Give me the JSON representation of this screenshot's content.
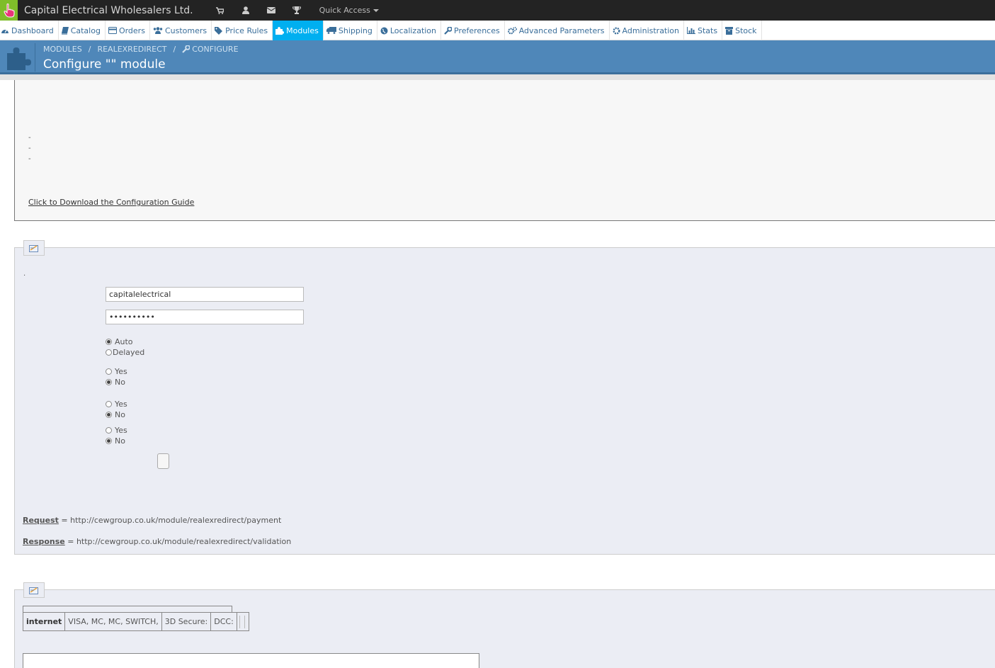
{
  "header": {
    "shop_name": "Capital Electrical Wholesalers Ltd.",
    "quick_access": "Quick Access",
    "icons": [
      "cart-icon",
      "user-icon",
      "envelope-icon",
      "trophy-icon"
    ]
  },
  "nav": {
    "items": [
      {
        "label": "Dashboard",
        "icon": "dashboard-icon"
      },
      {
        "label": "Catalog",
        "icon": "book-icon"
      },
      {
        "label": "Orders",
        "icon": "credit-card-icon"
      },
      {
        "label": "Customers",
        "icon": "users-icon"
      },
      {
        "label": "Price Rules",
        "icon": "tags-icon"
      },
      {
        "label": "Modules",
        "icon": "puzzle-icon",
        "active": true
      },
      {
        "label": "Shipping",
        "icon": "truck-icon"
      },
      {
        "label": "Localization",
        "icon": "globe-icon"
      },
      {
        "label": "Preferences",
        "icon": "wrench-icon"
      },
      {
        "label": "Advanced Parameters",
        "icon": "cogs-icon"
      },
      {
        "label": "Administration",
        "icon": "cog-icon"
      },
      {
        "label": "Stats",
        "icon": "bar-chart-icon"
      },
      {
        "label": "Stock",
        "icon": "archive-icon"
      }
    ],
    "active_color": "#00aff0"
  },
  "toolbar": {
    "breadcrumb": [
      "MODULES",
      "REALEXREDIRECT",
      "CONFIGURE"
    ],
    "title": "Configure \"\" module",
    "bg_color": "#4f87b9"
  },
  "intro": {
    "dashes": [
      "-",
      "-",
      "-"
    ],
    "download_link": "Click to Download the Configuration Guide"
  },
  "settings": {
    "dot": ".",
    "merchant_id": "capitalelectrical",
    "shared_secret": "••••••••••",
    "settlement": [
      {
        "label": "Auto",
        "checked": true
      },
      {
        "label": "Delayed",
        "checked": false
      }
    ],
    "group1": [
      {
        "label": "Yes",
        "checked": false
      },
      {
        "label": "No",
        "checked": true
      }
    ],
    "group2": [
      {
        "label": "Yes",
        "checked": false
      },
      {
        "label": "No",
        "checked": true
      }
    ],
    "group3": [
      {
        "label": "Yes",
        "checked": false
      },
      {
        "label": "No",
        "checked": true
      }
    ],
    "request_label": "Request",
    "request_url": "= http://cewgroup.co.uk/module/realexredirect/payment",
    "response_label": "Response",
    "response_url": "= http://cewgroup.co.uk/module/realexredirect/validation"
  },
  "accounts": {
    "row": [
      "internet",
      "VISA, MC, MC, SWITCH,",
      "3D Secure:",
      "DCC:"
    ]
  }
}
